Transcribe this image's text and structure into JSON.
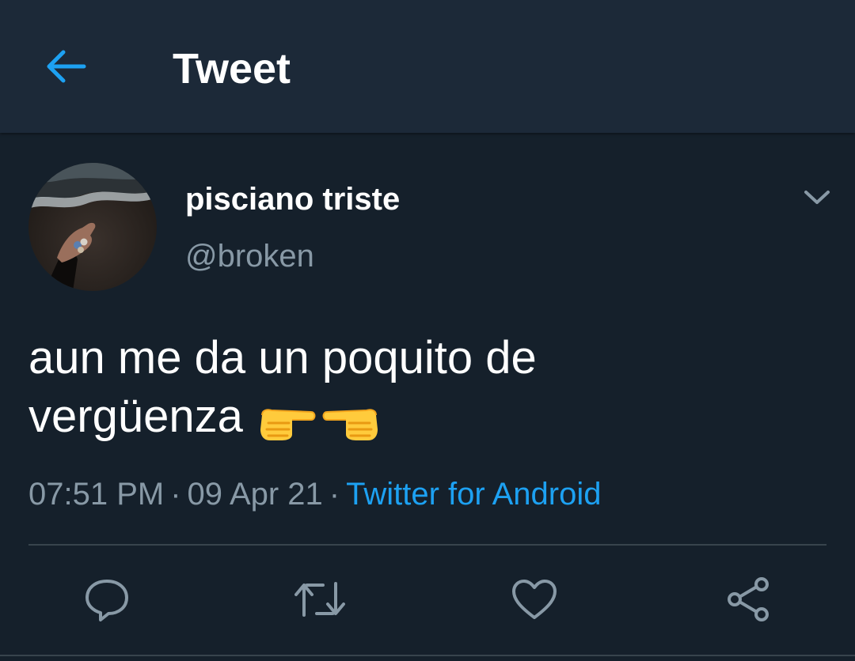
{
  "header": {
    "title": "Tweet",
    "back_icon": "arrow-left-icon"
  },
  "tweet": {
    "author": {
      "name": "pisciano triste",
      "handle": "@broken",
      "avatar": "avatar-image"
    },
    "text_line1": "aun me da un poquito de",
    "text_line2": "vergüenza",
    "emojis": [
      "pointing-right-emoji",
      "pointing-left-emoji"
    ],
    "time": "07:51 PM",
    "date": "09 Apr 21",
    "separator": "·",
    "source": "Twitter for Android"
  },
  "actions": [
    "reply-icon",
    "retweet-icon",
    "like-icon",
    "share-icon"
  ],
  "colors": {
    "background": "#15202b",
    "header": "#1c2938",
    "accent": "#1da1f2",
    "secondary_text": "#8899a6",
    "divider": "#38444d"
  }
}
